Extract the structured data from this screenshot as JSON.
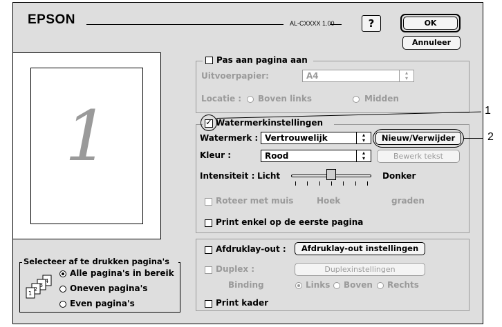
{
  "header": {
    "brand": "EPSON",
    "model": "AL-CXXXX 1.00",
    "help": "?"
  },
  "buttons": {
    "ok": "OK",
    "cancel": "Annuleer"
  },
  "preview": {
    "page_number": "1"
  },
  "fit_group": {
    "checkbox_label": "Pas aan pagina aan",
    "output_paper_label": "Uitvoerpapier:",
    "output_paper_value": "A4",
    "location_label": "Locatie :",
    "location_options": [
      "Boven links",
      "Midden"
    ]
  },
  "watermark_group": {
    "checkbox_label": "Watermerkinstellingen",
    "watermark_label": "Watermerk :",
    "watermark_value": "Vertrouwelijk",
    "new_remove_button": "Nieuw/Verwijder",
    "color_label": "Kleur :",
    "color_value": "Rood",
    "edit_text_button": "Bewerk tekst",
    "intensity_label": "Intensiteit :",
    "intensity_low": "Licht",
    "intensity_high": "Donker",
    "intensity_level": 0.5,
    "rotate_label": "Roteer met muis",
    "angle_label": "Hoek",
    "degrees_label": "graden",
    "first_page_only_label": "Print enkel op de eerste pagina"
  },
  "layout_group": {
    "layout_label": "Afdruklay-out :",
    "layout_button": "Afdruklay-out instellingen",
    "duplex_label": "Duplex :",
    "duplex_button": "Duplexinstellingen",
    "binding_label": "Binding",
    "binding_options": [
      "Links",
      "Boven",
      "Rechts"
    ],
    "print_frame_label": "Print kader"
  },
  "page_select_group": {
    "title": "Selecteer af te drukken pagina's",
    "options": [
      "Alle pagina's in bereik",
      "Oneven pagina's",
      "Even pagina's"
    ]
  },
  "callouts": [
    "1",
    "2"
  ]
}
